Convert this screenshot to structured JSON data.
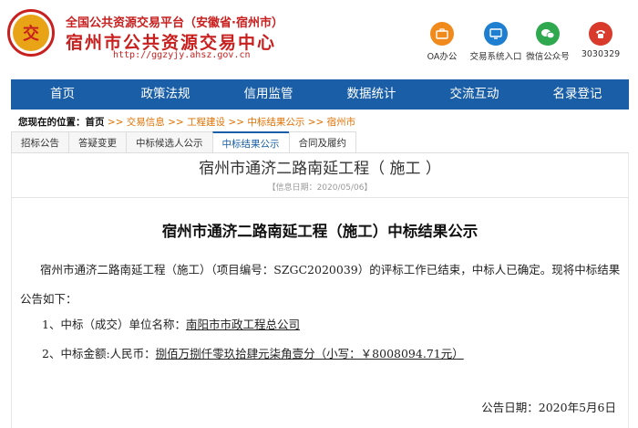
{
  "header": {
    "logo_char": "交",
    "subtitle": "全国公共资源交易平台（安徽省·宿州市）",
    "title": "宿州市公共资源交易中心",
    "url": "http://ggzyjy.ahsz.gov.cn",
    "quick_links": [
      {
        "label": "OA办公",
        "icon": "briefcase-icon",
        "color": "#f08a1c",
        "glyph": "▤"
      },
      {
        "label": "交易系统入口",
        "icon": "monitor-icon",
        "color": "#1e7fd0",
        "glyph": "▭"
      },
      {
        "label": "微信公众号",
        "icon": "wechat-icon",
        "color": "#2fa84f",
        "glyph": "✆"
      },
      {
        "label": "3030329",
        "icon": "phone-icon",
        "color": "#d83a2c",
        "glyph": "☎"
      }
    ]
  },
  "nav": [
    "首页",
    "政策法规",
    "信用监管",
    "数据统计",
    "交流互动",
    "名录登记"
  ],
  "breadcrumb": {
    "label": "您现在的位置：",
    "home": "首页",
    "items": [
      "交易信息",
      "工程建设",
      "中标结果公示",
      "宿州市"
    ]
  },
  "tabs": [
    "招标公告",
    "答疑变更",
    "中标候选人公示",
    "中标结果公示",
    "合同及履约"
  ],
  "doc": {
    "title": "宿州市通济二路南延工程（ 施工 ）",
    "date": "【信息日期：2020/05/06】",
    "ann_title": "宿州市通济二路南延工程（施工）中标结果公示",
    "para1": "宿州市通济二路南延工程（施工）（项目编号：SZGC2020039）的评标工作已结束，中标人已确定。现将中标结果公告如下：",
    "item1_label": "1、中标（成交）单位名称：",
    "item1_value": "南阳市市政工程总公司",
    "item2_label": "2、中标金额:人民币：",
    "item2_value": "捌佰万捌仟零玖拾肆元柒角壹分（小写：￥8008094.71元）",
    "sign_date": "公告日期：2020年5月6日"
  }
}
